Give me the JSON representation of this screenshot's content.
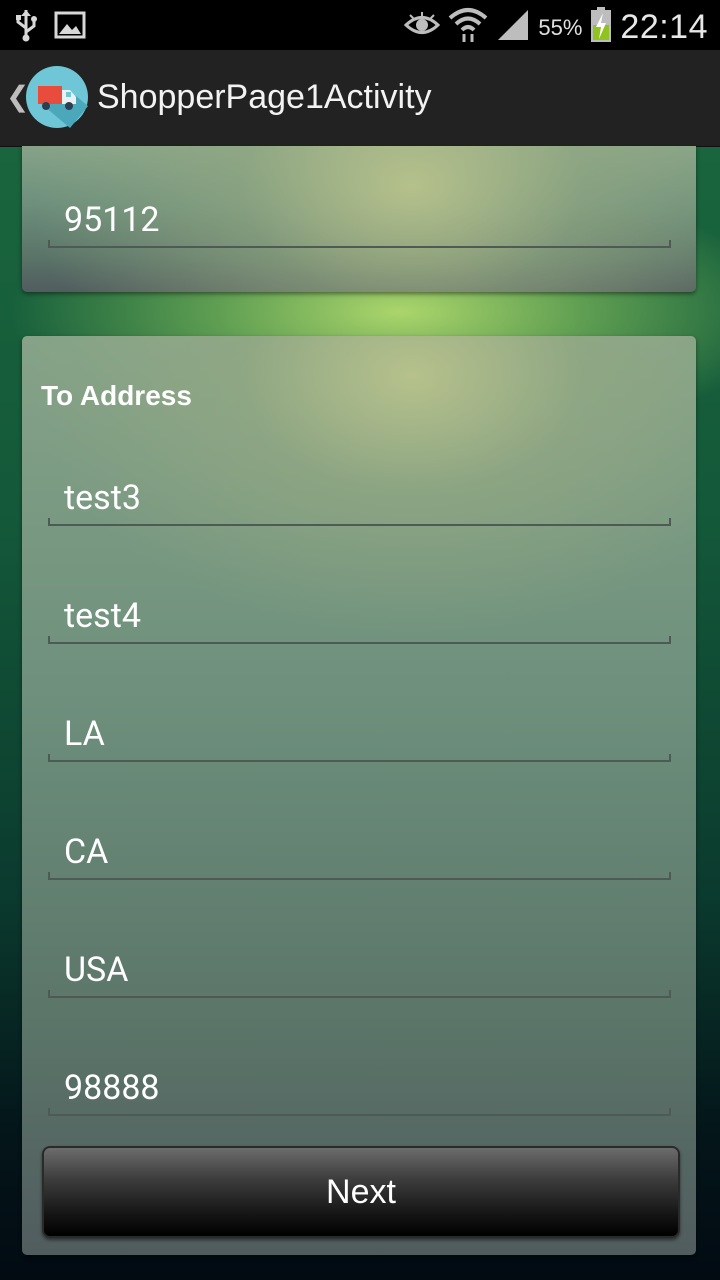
{
  "status_bar": {
    "battery_percent": "55%",
    "time": "22:14",
    "icons": [
      "usb-icon",
      "image-notification-icon",
      "eye-icon",
      "wifi-icon",
      "signal-icon",
      "battery-charging-icon"
    ]
  },
  "action_bar": {
    "title": "ShopperPage1Activity",
    "app_icon": "delivery-truck-icon",
    "back_icon": "chevron-left-icon"
  },
  "from_address": {
    "zip": "95112"
  },
  "to_address": {
    "title": "To Address",
    "fields": [
      "test3",
      "test4",
      "LA",
      "CA",
      "USA",
      "98888"
    ]
  },
  "next_button": {
    "label": "Next"
  },
  "colors": {
    "action_bar": "#222222",
    "status_bar": "#000000",
    "text": "#ffffff"
  }
}
